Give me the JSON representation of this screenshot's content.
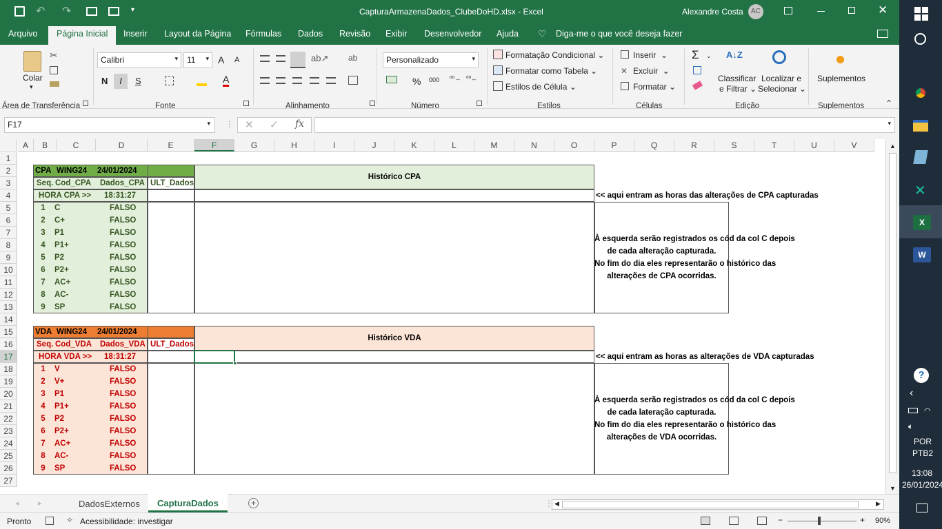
{
  "title": {
    "filename": "CapturaArmazenaDados_ClubeDoHD.xlsx",
    "sep": "-",
    "app": "Excel",
    "user": "Alexandre Costa",
    "initials": "AC"
  },
  "tabs": [
    "Arquivo",
    "Página Inicial",
    "Inserir",
    "Layout da Página",
    "Fórmulas",
    "Dados",
    "Revisão",
    "Exibir",
    "Desenvolvedor",
    "Ajuda"
  ],
  "tellme": "Diga-me o que você deseja fazer",
  "ribbon": {
    "paste": "Colar",
    "font": "Calibri",
    "size": "11",
    "bold": "N",
    "italic": "I",
    "underline": "S",
    "numfmt": "Personalizado",
    "pct": "%",
    "thousands": "000",
    "cond": "Formatação Condicional",
    "astable": "Formatar como Tabela",
    "cellstyles": "Estilos de Célula",
    "insert": "Inserir",
    "delete": "Excluir",
    "format": "Formatar",
    "sort1": "Classificar",
    "sort2": "e Filtrar",
    "find1": "Localizar e",
    "find2": "Selecionar",
    "addins": "Suplementos",
    "groups": [
      "Área de Transferência",
      "Fonte",
      "Alinhamento",
      "Número",
      "Estilos",
      "Células",
      "Edição",
      "Suplementos"
    ]
  },
  "namebox": "F17",
  "columns": [
    "A",
    "B",
    "C",
    "D",
    "E",
    "F",
    "G",
    "H",
    "I",
    "J",
    "K",
    "L",
    "M",
    "N",
    "O",
    "P",
    "Q",
    "R",
    "S",
    "T",
    "U",
    "V"
  ],
  "rows": [
    "1",
    "2",
    "3",
    "4",
    "5",
    "6",
    "7",
    "8",
    "9",
    "10",
    "11",
    "12",
    "13",
    "14",
    "15",
    "16",
    "17",
    "18",
    "19",
    "20",
    "21",
    "22",
    "23",
    "24",
    "25",
    "26",
    "27"
  ],
  "cpa": {
    "header": {
      "a": "CPA",
      "b": "WING24",
      "c": "24/01/2024"
    },
    "cols": [
      "Seq.",
      "Cod_CPA",
      "Dados_CPA",
      "ULT_Dados"
    ],
    "hora_label": "HORA CPA >>",
    "hora": "18:31:27",
    "historico": "Histórico CPA",
    "note": "<< aqui entram as horas das alterações de CPA capturadas",
    "items": [
      [
        "1",
        "C",
        "FALSO"
      ],
      [
        "2",
        "C+",
        "FALSO"
      ],
      [
        "3",
        "P1",
        "FALSO"
      ],
      [
        "4",
        "P1+",
        "FALSO"
      ],
      [
        "5",
        "P2",
        "FALSO"
      ],
      [
        "6",
        "P2+",
        "FALSO"
      ],
      [
        "7",
        "AC+",
        "FALSO"
      ],
      [
        "8",
        "AC-",
        "FALSO"
      ],
      [
        "9",
        "SP",
        "FALSO"
      ]
    ],
    "desc": [
      "À esquerda serão registrados os cód da col C depois",
      "de cada alteração capturada.",
      "No fim do dia eles representarão o histórico das",
      "alterações de CPA ocorridas."
    ]
  },
  "vda": {
    "header": {
      "a": "VDA",
      "b": "WING24",
      "c": "24/01/2024"
    },
    "cols": [
      "Seq.",
      "Cod_VDA",
      "Dados_VDA",
      "ULT_Dados"
    ],
    "hora_label": "HORA VDA >>",
    "hora": "18:31:27",
    "historico": "Histórico VDA",
    "note": "<< aqui entram as horas as alterações de VDA capturadas",
    "items": [
      [
        "1",
        "V",
        "FALSO"
      ],
      [
        "2",
        "V+",
        "FALSO"
      ],
      [
        "3",
        "P1",
        "FALSO"
      ],
      [
        "4",
        "P1+",
        "FALSO"
      ],
      [
        "5",
        "P2",
        "FALSO"
      ],
      [
        "6",
        "P2+",
        "FALSO"
      ],
      [
        "7",
        "AC+",
        "FALSO"
      ],
      [
        "8",
        "AC-",
        "FALSO"
      ],
      [
        "9",
        "SP",
        "FALSO"
      ]
    ],
    "desc": [
      "À esquerda serão registrados os cód da col C depois",
      "de cada lateração capturada.",
      "No fim do dia eles representarão o histórico das",
      "alterações de VDA ocorridas."
    ]
  },
  "sheets": [
    "DadosExternos",
    "CapturaDados"
  ],
  "status": {
    "ready": "Pronto",
    "access": "Acessibilidade: investigar",
    "zoom": "90%"
  },
  "taskbar": {
    "lang1": "POR",
    "lang2": "PTB2",
    "time": "13:08",
    "date": "26/01/2024"
  },
  "colors": {
    "excel": "#217346",
    "cpa_dark": "#70ad47",
    "cpa_light": "#e2efda",
    "cpa_text": "#375623",
    "vda_dark": "#ed7d31",
    "vda_light": "#fce4d6",
    "vda_text": "#c00000"
  }
}
